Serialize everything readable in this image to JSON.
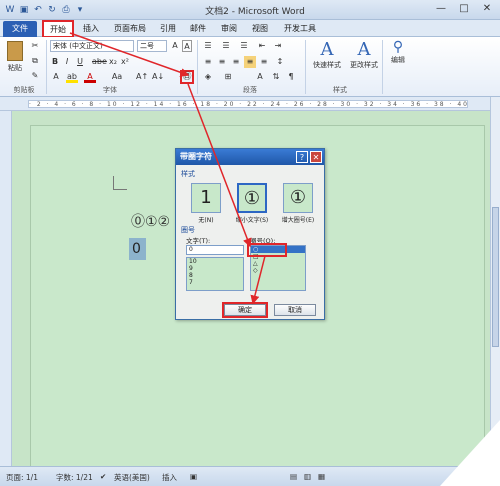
{
  "app": {
    "title": "文档2 - Microsoft Word",
    "window_controls": [
      "—",
      "□",
      "✕"
    ]
  },
  "tabs": [
    "文件",
    "开始",
    "插入",
    "页面布局",
    "引用",
    "邮件",
    "审阅",
    "视图",
    "开发工具"
  ],
  "ribbon": {
    "clipboard": {
      "paste_label": "粘贴",
      "group_label": "剪贴板"
    },
    "font": {
      "font_name": "宋体 (中文正文)",
      "font_size": "二号",
      "group_label": "字体"
    },
    "paragraph": {
      "group_label": "段落"
    },
    "styles": {
      "quick_styles_label": "快速样式",
      "change_styles_label": "更改样式",
      "group_label": "样式"
    },
    "editing": {
      "label": "编辑"
    }
  },
  "document": {
    "circled_text": "⓪①②",
    "selected_char": "0"
  },
  "dialog": {
    "title": "带圈字符",
    "style_section": "样式",
    "styles": [
      {
        "glyph": "1",
        "label": "无(N)"
      },
      {
        "glyph": "①",
        "label": "缩小文字(S)"
      },
      {
        "glyph": "①",
        "label": "增大圈号(E)"
      }
    ],
    "enclosure_section": "圈号",
    "text_label": "文字(T):",
    "text_value": "0",
    "text_list": [
      "10",
      "9",
      "8",
      "7"
    ],
    "circle_label": "圈号(O):",
    "circle_list": [
      "○",
      "□",
      "△",
      "◇"
    ],
    "ok_label": "确定",
    "cancel_label": "取消"
  },
  "status": {
    "page": "页面: 1/1",
    "words": "字数: 1/21",
    "language": "英语(美国)",
    "mode": "插入"
  }
}
